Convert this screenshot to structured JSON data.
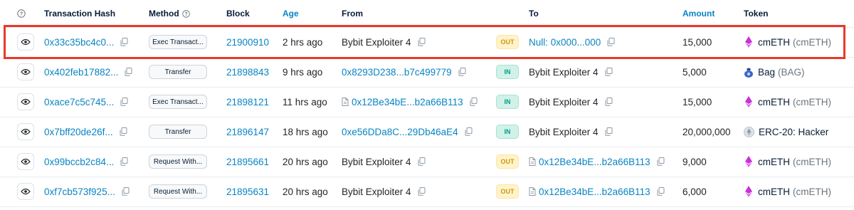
{
  "header": {
    "hash": "Transaction Hash",
    "method": "Method",
    "block": "Block",
    "age": "Age",
    "from": "From",
    "to": "To",
    "amount": "Amount",
    "token": "Token"
  },
  "colors": {
    "link": "#0784c3",
    "highlight": "#e8392b",
    "out": "#cc9a06",
    "in": "#00a186"
  },
  "rows": [
    {
      "hash": "0x33c35bc4c0...",
      "method": "Exec Transact...",
      "block": "21900910",
      "age": "2 hrs ago",
      "from": "Bybit Exploiter 4",
      "direction": "OUT",
      "to": "Null: 0x000...000",
      "amount": "15,000",
      "token_name": "cmETH",
      "token_symbol": "(cmETH)",
      "token_icon": "cmeth-icon"
    },
    {
      "hash": "0x402feb17882...",
      "method": "Transfer",
      "block": "21898843",
      "age": "9 hrs ago",
      "from": "0x8293D238...b7c499779",
      "direction": "IN",
      "to": "Bybit Exploiter 4",
      "amount": "5,000",
      "token_name": "Bag",
      "token_symbol": "(BAG)",
      "token_icon": "bag-icon"
    },
    {
      "hash": "0xace7c5c745...",
      "method": "Exec Transact...",
      "block": "21898121",
      "age": "11 hrs ago",
      "from": "0x12Be34bE...b2a66B113",
      "direction": "IN",
      "to": "Bybit Exploiter 4",
      "amount": "15,000",
      "token_name": "cmETH",
      "token_symbol": "(cmETH)",
      "token_icon": "cmeth-icon"
    },
    {
      "hash": "0x7bff20de26f...",
      "method": "Transfer",
      "block": "21896147",
      "age": "18 hrs ago",
      "from": "0xe56DDa8C...29Db46aE4",
      "direction": "IN",
      "to": "Bybit Exploiter 4",
      "amount": "20,000,000",
      "token_name": "ERC-20: Hacker",
      "token_symbol": "",
      "token_icon": "erc20-icon"
    },
    {
      "hash": "0x99bccb2c84...",
      "method": "Request With...",
      "block": "21895661",
      "age": "20 hrs ago",
      "from": "Bybit Exploiter 4",
      "direction": "OUT",
      "to": "0x12Be34bE...b2a66B113",
      "amount": "9,000",
      "token_name": "cmETH",
      "token_symbol": "(cmETH)",
      "token_icon": "cmeth-icon"
    },
    {
      "hash": "0xf7cb573f925...",
      "method": "Request With...",
      "block": "21895631",
      "age": "20 hrs ago",
      "from": "Bybit Exploiter 4",
      "direction": "OUT",
      "to": "0x12Be34bE...b2a66B113",
      "amount": "6,000",
      "token_name": "cmETH",
      "token_symbol": "(cmETH)",
      "token_icon": "cmeth-icon"
    }
  ]
}
